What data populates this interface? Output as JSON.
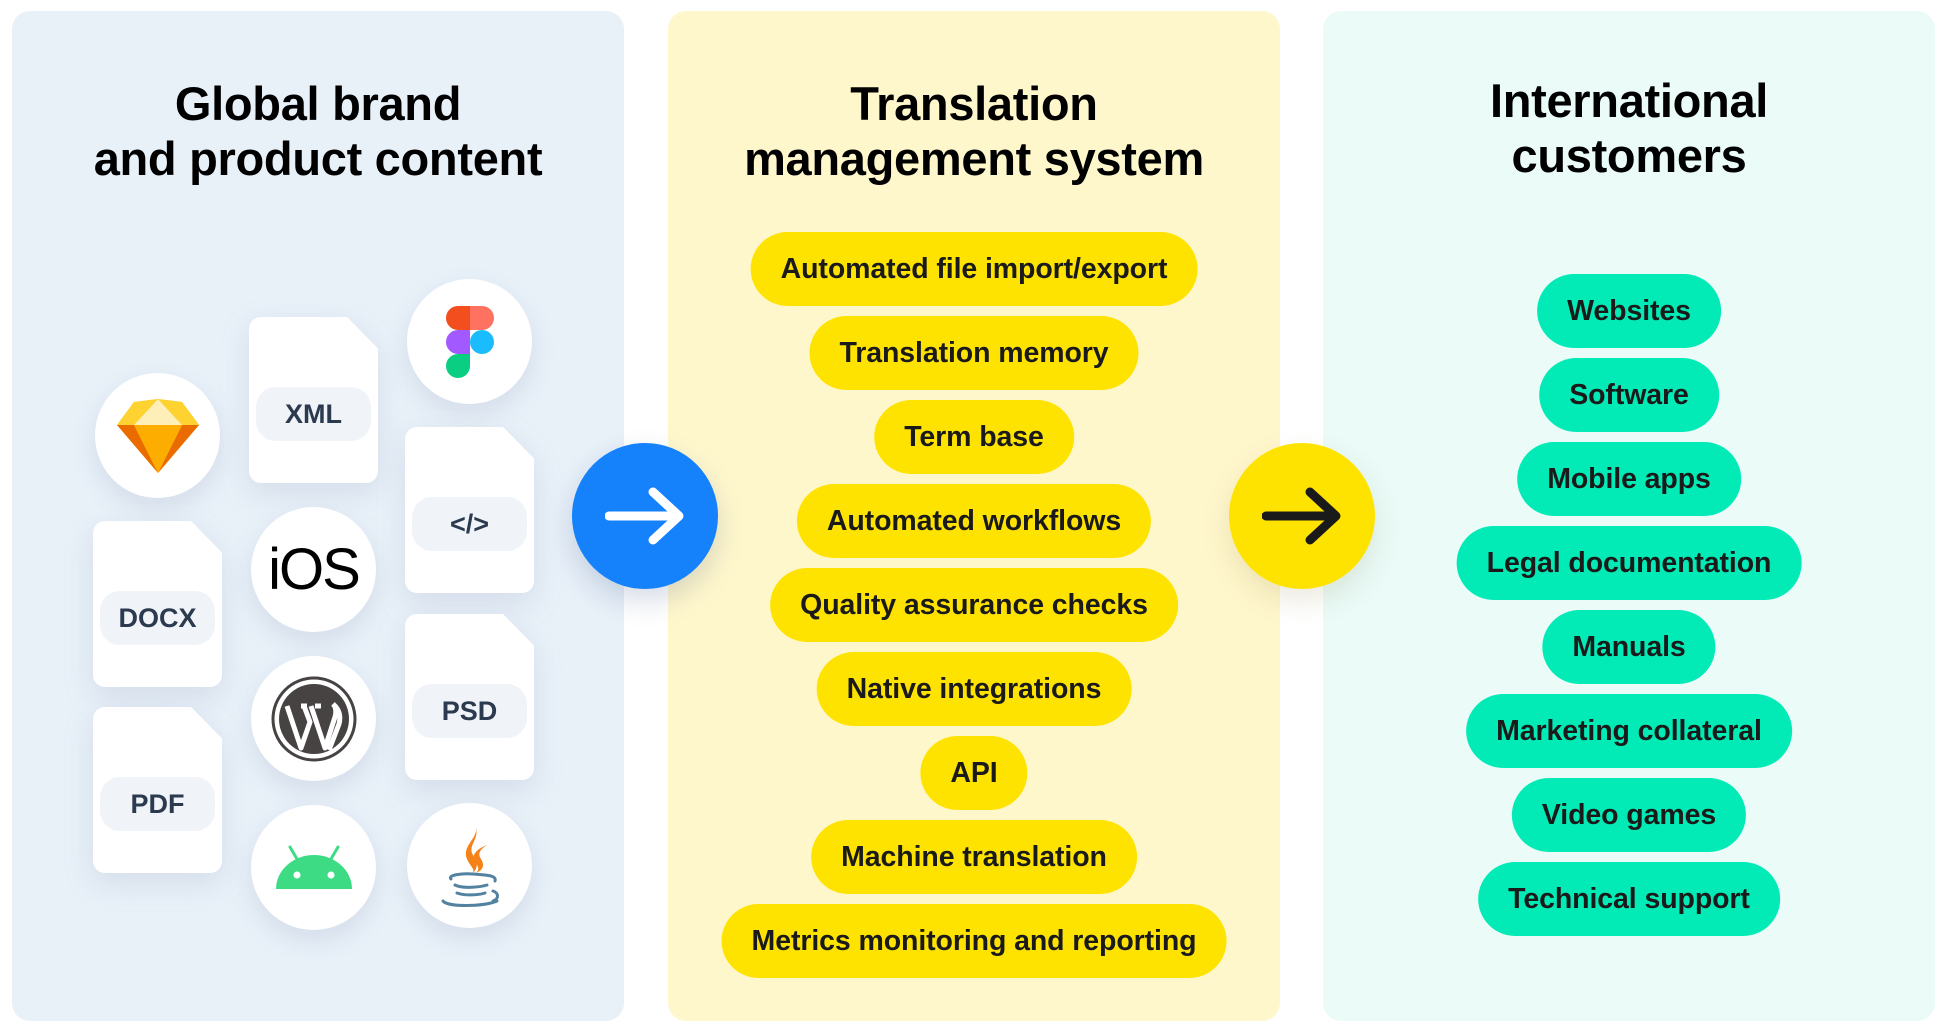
{
  "panels": {
    "source": {
      "title_lines": [
        "Global brand",
        "and product content"
      ],
      "background": "#E8F0F8",
      "file_types": [
        "XML",
        "</>",
        "DOCX",
        "PSD",
        "PDF"
      ],
      "platform_icons": [
        "sketch-icon",
        "figma-icon",
        "ios-icon",
        "wordpress-icon",
        "android-icon",
        "java-icon"
      ],
      "ios_label": "iOS"
    },
    "tms": {
      "title_lines": [
        "Translation",
        "management system"
      ],
      "background": "#FFF7CC",
      "pill_color": "#FFE300",
      "features": [
        "Automated file import/export",
        "Translation memory",
        "Term base",
        "Automated workflows",
        "Quality assurance checks",
        "Native integrations",
        "API",
        "Machine translation",
        "Metrics monitoring and reporting"
      ]
    },
    "customers": {
      "title_lines": [
        "International",
        "customers"
      ],
      "background": "#EAFBF8",
      "pill_color": "#02EBB6",
      "outputs": [
        "Websites",
        "Software",
        "Mobile apps",
        "Legal documentation",
        "Manuals",
        "Marketing collateral",
        "Video games",
        "Technical support"
      ]
    }
  },
  "connectors": {
    "first": {
      "icon": "arrow-right-icon",
      "color": "#1581FA"
    },
    "second": {
      "icon": "arrow-right-icon",
      "color": "#FFE300"
    }
  }
}
